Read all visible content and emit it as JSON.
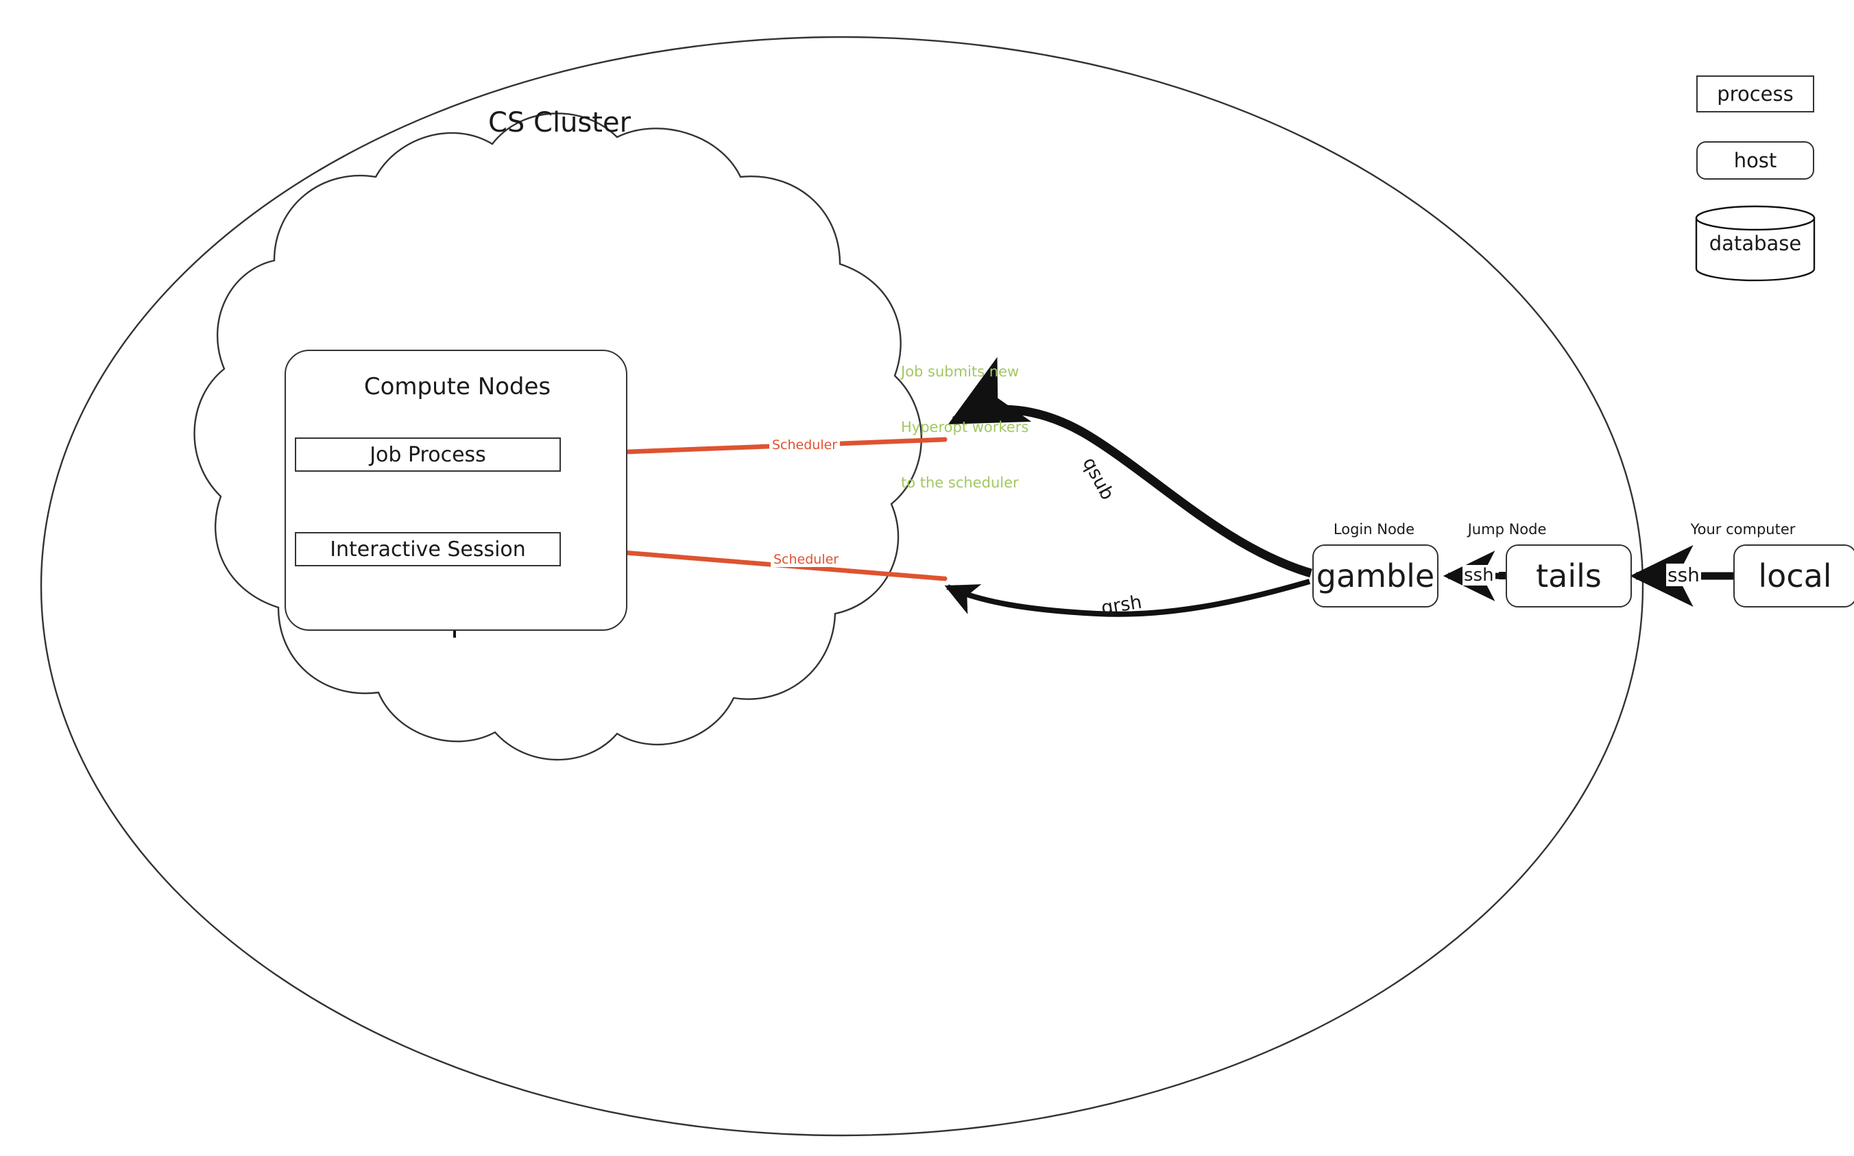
{
  "diagram": {
    "title": "CS Cluster",
    "cluster_label": "CS Cluster",
    "cloud": {
      "name": "compute-cloud"
    },
    "compute_group": {
      "label": "Compute Nodes",
      "processes": [
        {
          "id": "job-process",
          "label": "Job Process"
        },
        {
          "id": "interactive-session",
          "label": "Interactive Session"
        }
      ]
    },
    "hosts": [
      {
        "id": "gamble",
        "caption": "Login Node",
        "label": "gamble"
      },
      {
        "id": "tails",
        "caption": "Jump Node",
        "label": "tails"
      },
      {
        "id": "local",
        "caption": "Your computer",
        "label": "local"
      }
    ],
    "edges": [
      {
        "id": "qsub",
        "label": "qsub",
        "from": "gamble",
        "to": "job-process-area",
        "style": "thick-curve"
      },
      {
        "id": "qrsh",
        "label": "qrsh",
        "from": "gamble",
        "to": "interactive-session-area",
        "style": "curve"
      },
      {
        "id": "ssh-tails-gamble",
        "label": "ssh",
        "from": "tails",
        "to": "gamble",
        "style": "straight"
      },
      {
        "id": "ssh-local-tails",
        "label": "ssh",
        "from": "local",
        "to": "tails",
        "style": "straight"
      },
      {
        "id": "scheduler-job",
        "label": "Scheduler",
        "from": "scheduler",
        "to": "job-process",
        "style": "dotted"
      },
      {
        "id": "scheduler-interactive",
        "label": "Scheduler",
        "from": "scheduler",
        "to": "interactive-session",
        "style": "dotted"
      }
    ],
    "annotation": {
      "id": "hyperopt-note",
      "lines": [
        "Job submits new",
        "Hyperopt workers",
        "to the scheduler"
      ],
      "line1": "Job submits new",
      "line2": "Hyperopt workers",
      "line3": "to the scheduler"
    },
    "legend": {
      "process": "process",
      "host": "host",
      "database": "database"
    },
    "colors": {
      "scheduler_red": "#DE5330",
      "annotation_green": "#A2C862",
      "stroke": "#333333",
      "ink": "#1a1a1a",
      "background": "#ffffff"
    }
  }
}
